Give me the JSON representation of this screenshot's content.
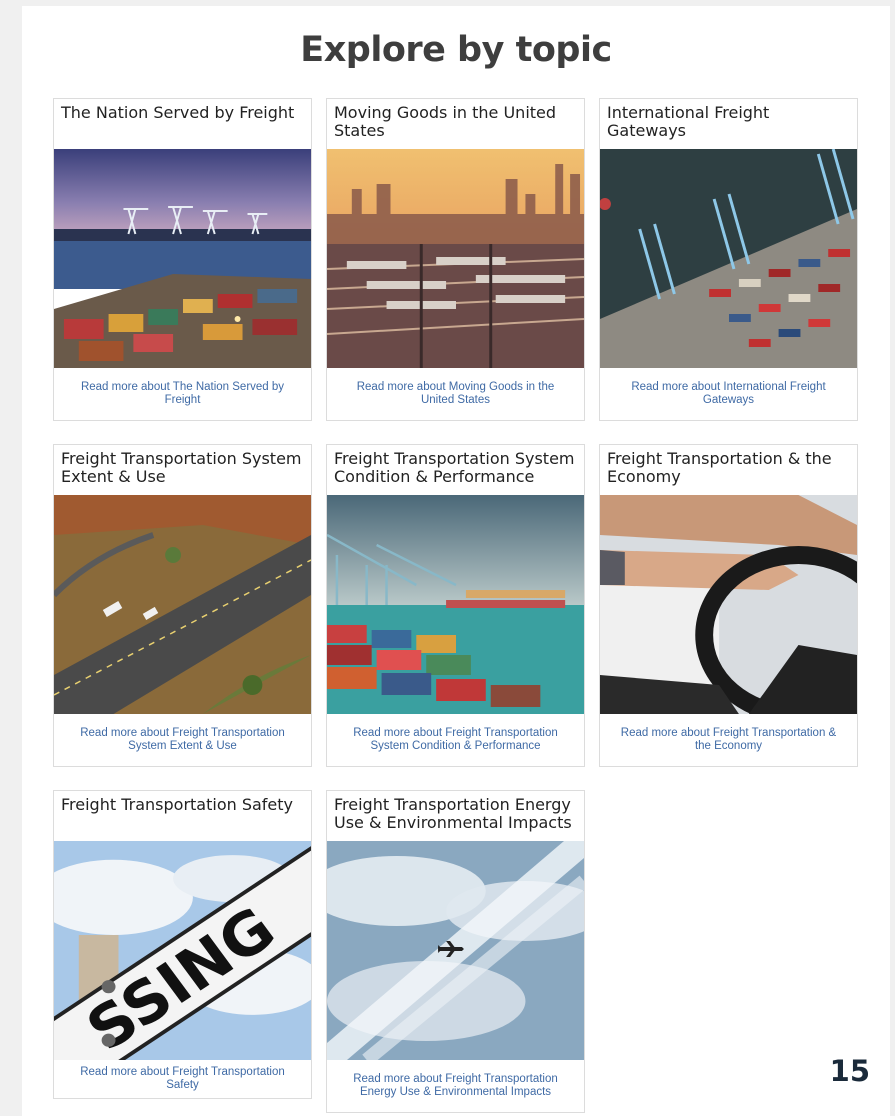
{
  "heading": "Explore by topic",
  "page_number": "15",
  "cards": [
    {
      "title": "The Nation Served by Freight",
      "link": "Read more about The Nation Served by Freight",
      "image": "container-port-dusk"
    },
    {
      "title": "Moving Goods in the United States",
      "link": "Read more about Moving Goods in the United States",
      "image": "rail-yard-city-skyline"
    },
    {
      "title": "International Freight Gateways",
      "link": "Read more about International Freight Gateways",
      "image": "aerial-port-cranes"
    },
    {
      "title": "Freight Transportation System Extent & Use",
      "link": "Read more about Freight Transportation System Extent & Use",
      "image": "highway-trucks-desert"
    },
    {
      "title": "Freight Transportation System Condition & Performance",
      "link": "Read more about Freight Transportation System Condition & Performance",
      "image": "port-cranes-containers"
    },
    {
      "title": "Freight Transportation & the Economy",
      "link": "Read more about Freight Transportation & the Economy",
      "image": "hands-steering-wheel"
    },
    {
      "title": "Freight Transportation Safety",
      "link": "Read more about Freight Transportation Safety",
      "image": "railroad-crossing-sign",
      "image_text": "SSING"
    },
    {
      "title": "Freight Transportation Energy Use & Environmental Impacts",
      "link": "Read more about Freight Transportation Energy Use & Environmental Impacts",
      "image": "airplane-sky-contrails"
    }
  ]
}
